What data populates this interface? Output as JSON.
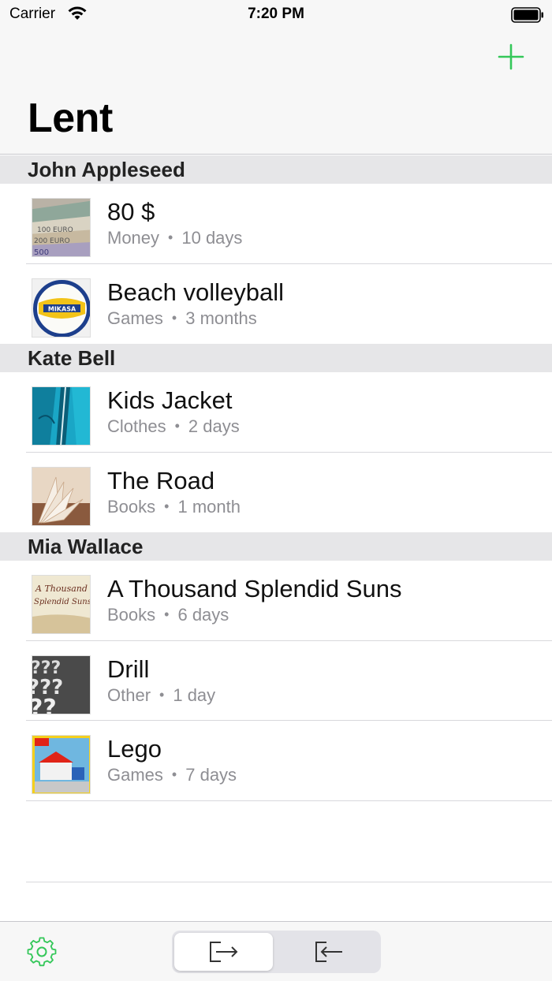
{
  "status_bar": {
    "carrier": "Carrier",
    "time": "7:20 PM",
    "icons": [
      "wifi-icon",
      "battery-icon"
    ]
  },
  "nav": {
    "title": "Lent",
    "add_icon": "plus-icon"
  },
  "colors": {
    "accent": "#34c759",
    "section_bg": "#e6e6e8",
    "secondary_text": "#8e8e93"
  },
  "sections": [
    {
      "header": "John Appleseed",
      "items": [
        {
          "title": "80 $",
          "category": "Money",
          "duration": "10 days",
          "thumbnail": "banknotes-photo"
        },
        {
          "title": "Beach volleyball",
          "category": "Games",
          "duration": "3 months",
          "thumbnail": "volleyball-photo"
        }
      ]
    },
    {
      "header": "Kate Bell",
      "items": [
        {
          "title": "Kids Jacket",
          "category": "Clothes",
          "duration": "2 days",
          "thumbnail": "jacket-photo"
        },
        {
          "title": "The Road",
          "category": "Books",
          "duration": "1 month",
          "thumbnail": "open-book-photo"
        }
      ]
    },
    {
      "header": "Mia Wallace",
      "items": [
        {
          "title": "A Thousand Splendid Suns",
          "category": "Books",
          "duration": "6 days",
          "thumbnail": "book-cover-photo"
        },
        {
          "title": "Drill",
          "category": "Other",
          "duration": "1 day",
          "thumbnail": "question-marks-photo"
        },
        {
          "title": "Lego",
          "category": "Games",
          "duration": "7 days",
          "thumbnail": "lego-box-photo"
        }
      ]
    }
  ],
  "tab_bar": {
    "settings_icon": "gear-icon",
    "segments": [
      {
        "icon": "lent-out-icon",
        "selected": true
      },
      {
        "icon": "borrowed-in-icon",
        "selected": false
      }
    ]
  }
}
